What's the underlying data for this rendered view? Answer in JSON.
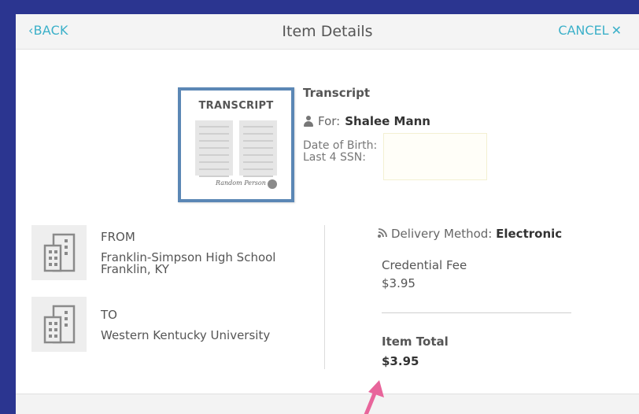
{
  "header": {
    "back_label": "BACK",
    "title": "Item Details",
    "cancel_label": "CANCEL"
  },
  "item": {
    "thumbnail_title": "TRANSCRIPT",
    "thumbnail_signature": "Random Person",
    "name": "Transcript",
    "for_label": "For:",
    "recipient": "Shalee Mann",
    "dob_label": "Date of Birth:",
    "ssn_label": "Last 4 SSN:"
  },
  "from": {
    "label": "FROM",
    "line1": "Franklin-Simpson High School",
    "line2": "Franklin, KY"
  },
  "to": {
    "label": "TO",
    "line1": "Western Kentucky University"
  },
  "delivery": {
    "label": "Delivery Method:",
    "value": "Electronic"
  },
  "fees": {
    "credential_label": "Credential Fee",
    "credential_value": "$3.95",
    "total_label": "Item Total",
    "total_value": "$3.95"
  },
  "colors": {
    "accent": "#3bb0c9",
    "frame": "#2b3590",
    "thumbnail_border": "#5b87b5",
    "annotation_arrow": "#e8659b"
  }
}
